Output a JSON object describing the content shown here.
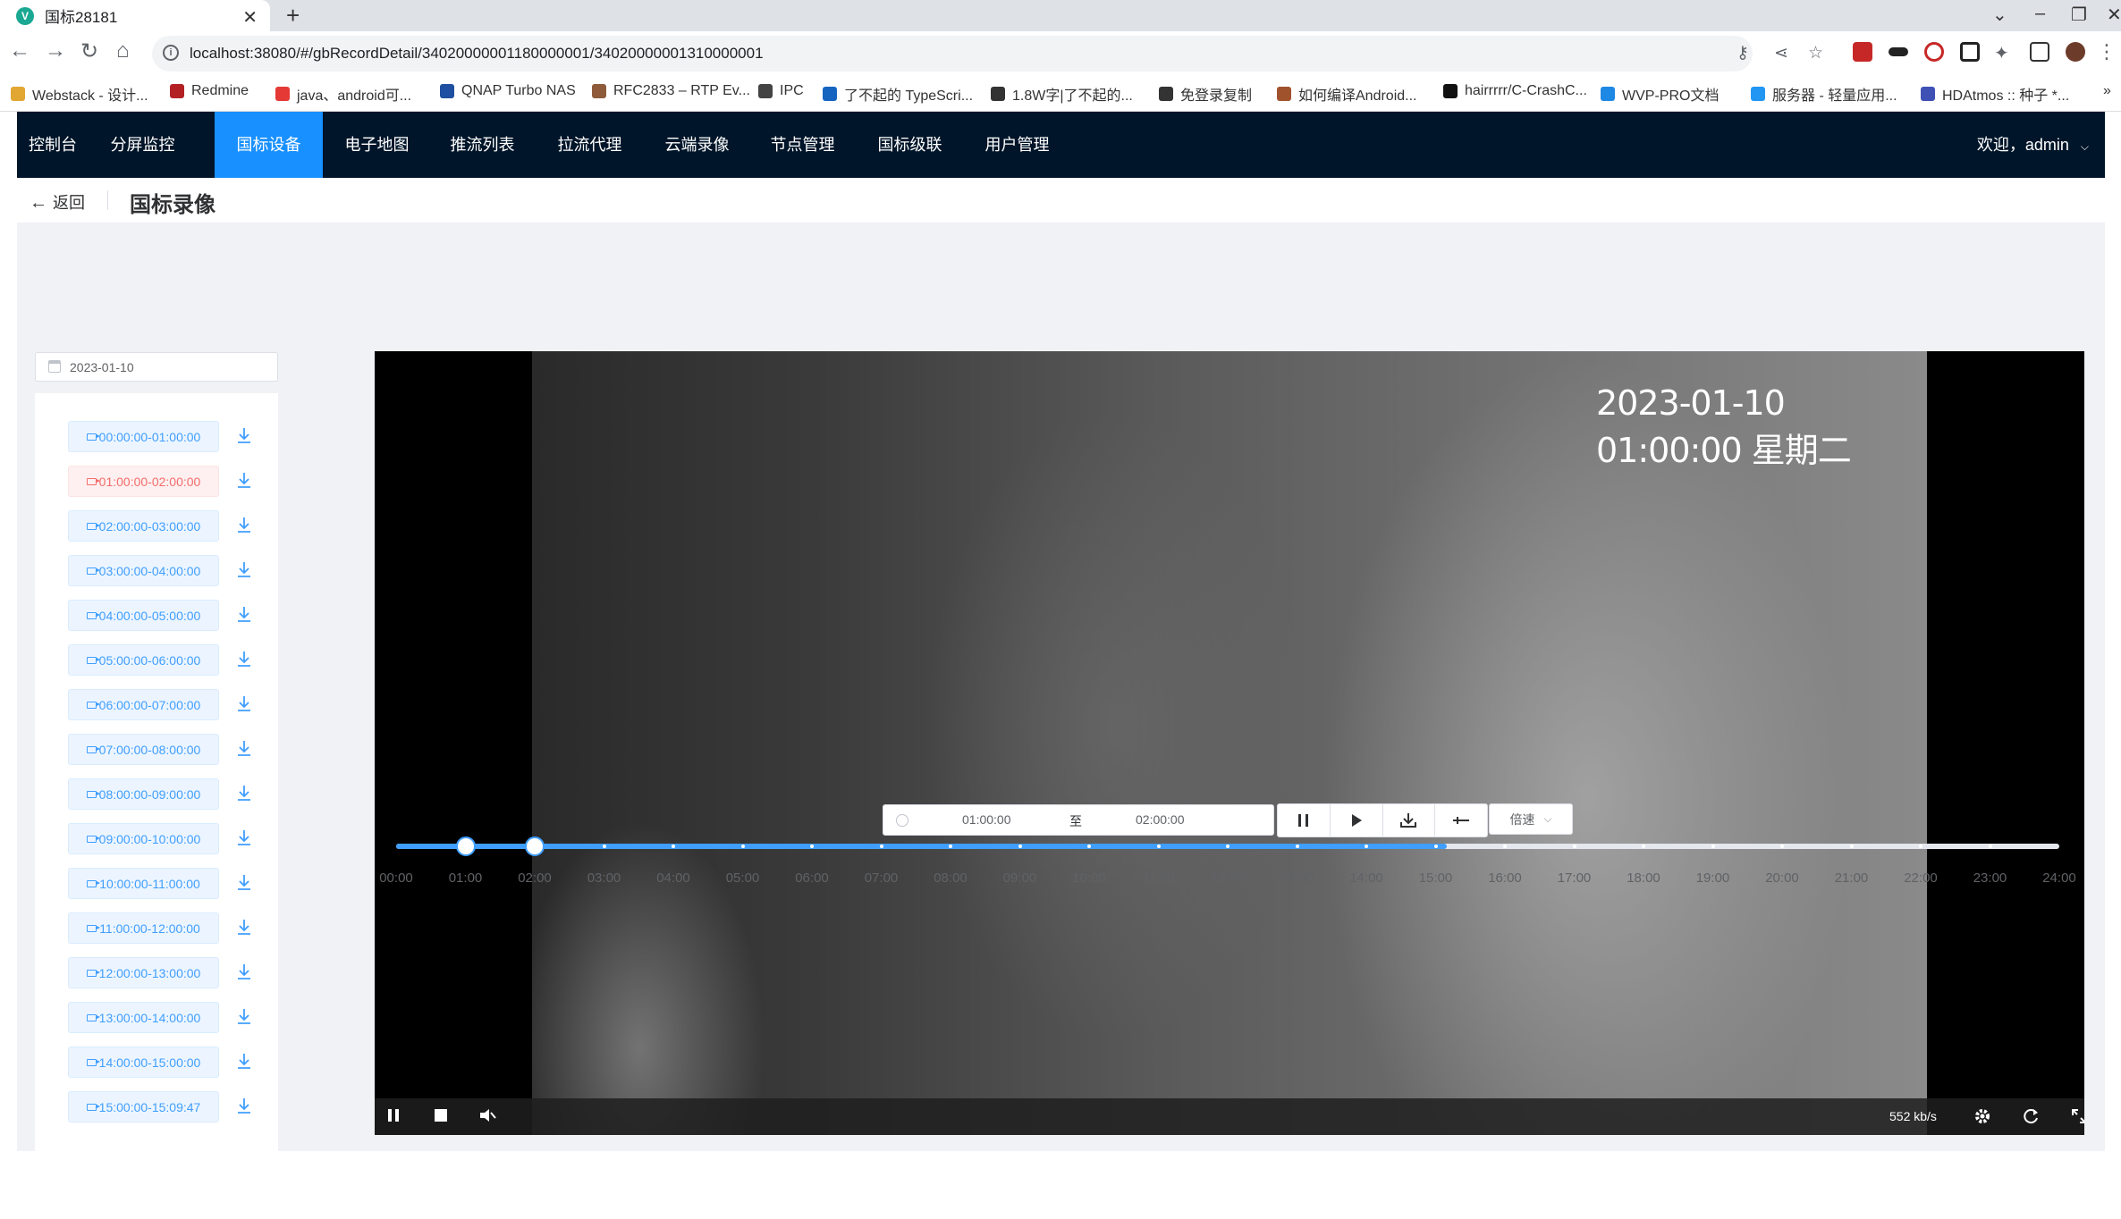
{
  "browser": {
    "tab_title": "国标28181",
    "url": "localhost:38080/#/gbRecordDetail/34020000001180000001/34020000001310000001",
    "bookmarks": [
      {
        "label": "Webstack - 设计...",
        "color": "#e2a632"
      },
      {
        "label": "Redmine",
        "color": "#b32024"
      },
      {
        "label": "java、android可...",
        "color": "#e53935"
      },
      {
        "label": "QNAP Turbo NAS",
        "color": "#1e4fa0"
      },
      {
        "label": "RFC2833 – RTP Ev...",
        "color": "#8d5b3a"
      },
      {
        "label": "IPC",
        "color": "#444444"
      },
      {
        "label": "了不起的 TypeScri...",
        "color": "#1565c0"
      },
      {
        "label": "1.8W字|了不起的...",
        "color": "#333333"
      },
      {
        "label": "免登录复制",
        "color": "#333333"
      },
      {
        "label": "如何编译Android...",
        "color": "#a0522d"
      },
      {
        "label": "hairrrrr/C-CrashC...",
        "color": "#111111"
      },
      {
        "label": "WVP-PRO文档",
        "color": "#1e88e5"
      },
      {
        "label": "服务器 - 轻量应用...",
        "color": "#2196f3"
      },
      {
        "label": "HDAtmos :: 种子 *...",
        "color": "#3f51b5"
      }
    ]
  },
  "nav": {
    "items": [
      "控制台",
      "分屏监控",
      "国标设备",
      "电子地图",
      "推流列表",
      "拉流代理",
      "云端录像",
      "节点管理",
      "国标级联",
      "用户管理"
    ],
    "active_index": 2,
    "welcome": "欢迎，admin"
  },
  "page": {
    "back_label": "返回",
    "title": "国标录像"
  },
  "sidebar": {
    "date": "2023-01-10",
    "segments": [
      "00:00:00-01:00:00",
      "01:00:00-02:00:00",
      "02:00:00-03:00:00",
      "03:00:00-04:00:00",
      "04:00:00-05:00:00",
      "05:00:00-06:00:00",
      "06:00:00-07:00:00",
      "07:00:00-08:00:00",
      "08:00:00-09:00:00",
      "09:00:00-10:00:00",
      "10:00:00-11:00:00",
      "11:00:00-12:00:00",
      "12:00:00-13:00:00",
      "13:00:00-14:00:00",
      "14:00:00-15:00:00",
      "15:00:00-15:09:47"
    ],
    "active_index": 1
  },
  "player": {
    "osd_text": "2023-01-10 01:00:00 星期二",
    "bitrate": "552 kb/s"
  },
  "controls": {
    "start_time": "01:00:00",
    "range_sep": "至",
    "end_time": "02:00:00",
    "speed_label": "倍速"
  },
  "timeline": {
    "labels": [
      "00:00",
      "01:00",
      "02:00",
      "03:00",
      "04:00",
      "05:00",
      "06:00",
      "07:00",
      "08:00",
      "09:00",
      "10:00",
      "11:00",
      "12:00",
      "13:00",
      "14:00",
      "15:00",
      "16:00",
      "17:00",
      "18:00",
      "19:00",
      "20:00",
      "21:00",
      "22:00",
      "23:00",
      "24:00"
    ],
    "recorded_until_hours": 15.16,
    "selected_start_hours": 1,
    "selected_end_hours": 2
  }
}
